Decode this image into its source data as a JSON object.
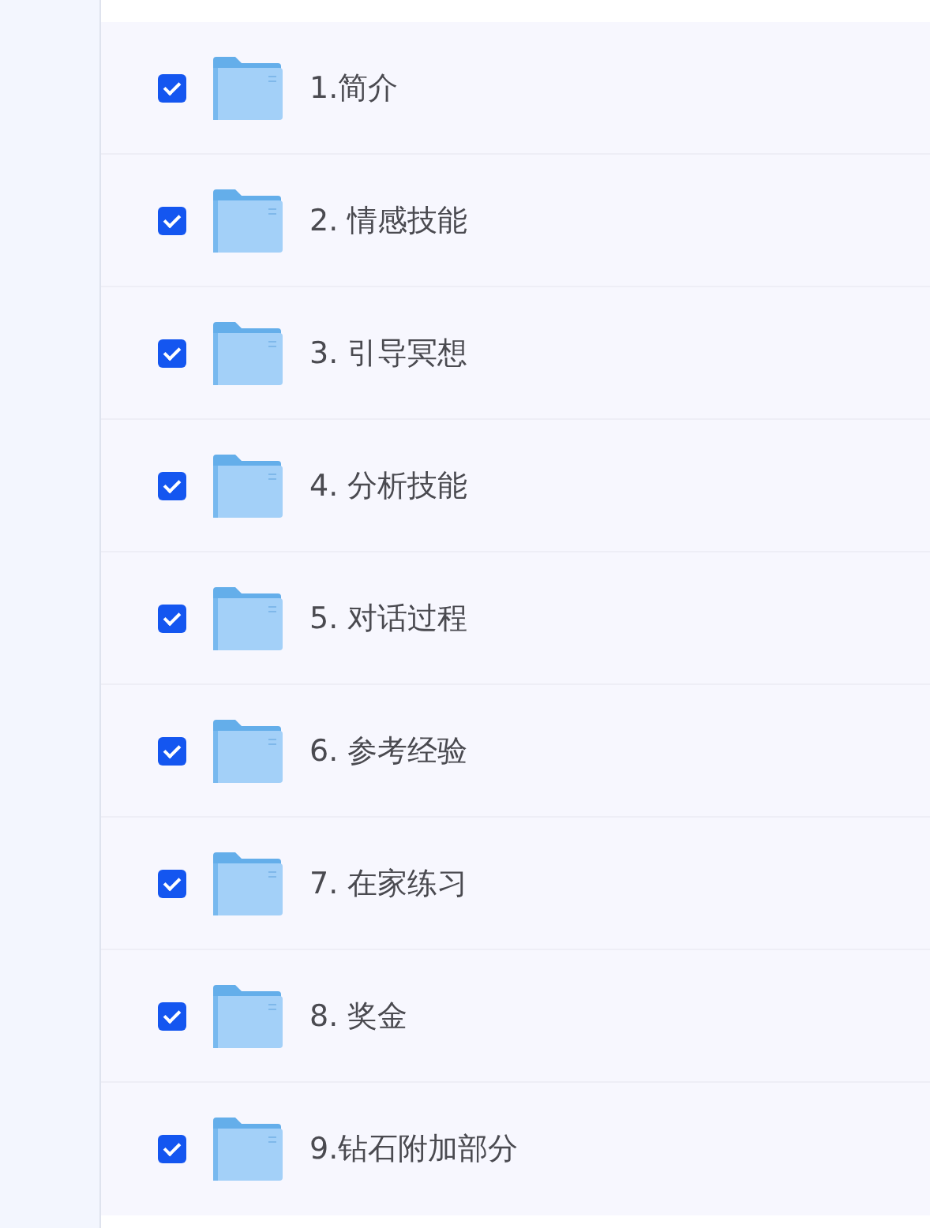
{
  "folders": [
    {
      "name": "1.简介",
      "checked": true
    },
    {
      "name": "2. 情感技能",
      "checked": true
    },
    {
      "name": "3. 引导冥想",
      "checked": true
    },
    {
      "name": "4. 分析技能",
      "checked": true
    },
    {
      "name": "5. 对话过程",
      "checked": true
    },
    {
      "name": "6. 参考经验",
      "checked": true
    },
    {
      "name": "7. 在家练习",
      "checked": true
    },
    {
      "name": "8. 奖金",
      "checked": true
    },
    {
      "name": "9.钻石附加部分",
      "checked": true
    }
  ]
}
